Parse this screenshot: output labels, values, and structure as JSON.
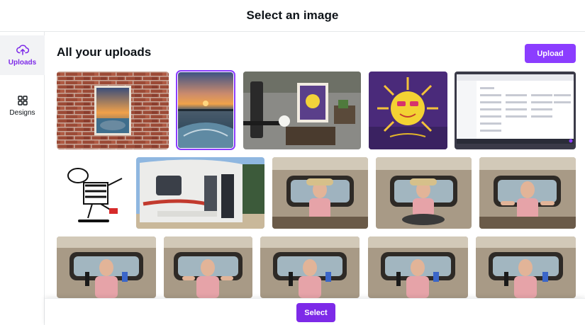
{
  "dialog": {
    "title": "Select an image"
  },
  "sidebar": {
    "items": [
      {
        "label": "Uploads",
        "icon": "cloud-upload-icon",
        "active": true
      },
      {
        "label": "Designs",
        "icon": "grid-icon",
        "active": false
      }
    ]
  },
  "main": {
    "title": "All your uploads",
    "upload_label": "Upload"
  },
  "footer": {
    "select_label": "Select"
  },
  "colors": {
    "accent": "#8b3dff",
    "accent_dark": "#7d2ae8",
    "active_bg": "#f2f3f5",
    "border": "#e6e8ea"
  },
  "thumbnails": [
    {
      "name": "brick-wall-sunset-photo",
      "selected": false
    },
    {
      "name": "sunset-boat-photo",
      "selected": true
    },
    {
      "name": "sun-painting-on-table-photo",
      "selected": false
    },
    {
      "name": "sun-cartoon-illustration",
      "selected": false
    },
    {
      "name": "app-screenshot",
      "selected": false
    },
    {
      "name": "zebra-skateboard-drawing",
      "selected": false
    },
    {
      "name": "camper-trailer-photo",
      "selected": false
    },
    {
      "name": "woman-in-van-photo-1",
      "selected": false
    },
    {
      "name": "woman-in-van-photo-2",
      "selected": false
    },
    {
      "name": "woman-in-van-photo-3",
      "selected": false
    },
    {
      "name": "woman-holding-items-photo-1",
      "selected": false
    },
    {
      "name": "woman-holding-items-photo-2",
      "selected": false
    },
    {
      "name": "woman-holding-items-photo-3",
      "selected": false
    },
    {
      "name": "woman-holding-items-photo-4",
      "selected": false
    },
    {
      "name": "woman-holding-items-photo-5",
      "selected": false
    }
  ]
}
